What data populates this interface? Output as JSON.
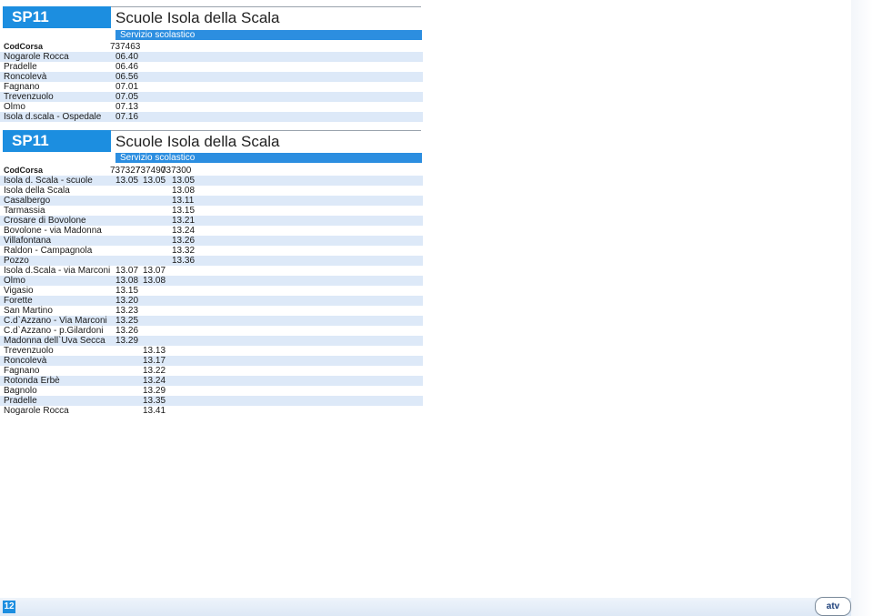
{
  "sections": [
    {
      "code": "SP11",
      "title": "Scuole Isola della Scala",
      "subtitle": "Servizio scolastico",
      "cod_label": "CodCorsa",
      "codes": [
        "737463"
      ],
      "stops": [
        {
          "name": "Nogarole Rocca",
          "times": [
            "06.40"
          ]
        },
        {
          "name": "Pradelle",
          "times": [
            "06.46"
          ]
        },
        {
          "name": "Roncolevà",
          "times": [
            "06.56"
          ]
        },
        {
          "name": "Fagnano",
          "times": [
            "07.01"
          ]
        },
        {
          "name": "Trevenzuolo",
          "times": [
            "07.05"
          ]
        },
        {
          "name": "Olmo",
          "times": [
            "07.13"
          ]
        },
        {
          "name": "Isola d.scala - Ospedale",
          "times": [
            "07.16"
          ]
        }
      ]
    },
    {
      "code": "SP11",
      "title": "Scuole Isola della Scala",
      "subtitle": "Servizio scolastico",
      "cod_label": "CodCorsa",
      "codes": [
        "737327",
        "737490",
        "737300"
      ],
      "stops": [
        {
          "name": "Isola d. Scala - scuole",
          "times": [
            "13.05",
            "13.05",
            "13.05"
          ]
        },
        {
          "name": "Isola della Scala",
          "times": [
            "",
            "",
            "13.08"
          ]
        },
        {
          "name": "Casalbergo",
          "times": [
            "",
            "",
            "13.11"
          ]
        },
        {
          "name": "Tarmassia",
          "times": [
            "",
            "",
            "13.15"
          ]
        },
        {
          "name": "Crosare di Bovolone",
          "times": [
            "",
            "",
            "13.21"
          ]
        },
        {
          "name": "Bovolone - via Madonna",
          "times": [
            "",
            "",
            "13.24"
          ]
        },
        {
          "name": "Villafontana",
          "times": [
            "",
            "",
            "13.26"
          ]
        },
        {
          "name": "Raldon - Campagnola",
          "times": [
            "",
            "",
            "13.32"
          ]
        },
        {
          "name": "Pozzo",
          "times": [
            "",
            "",
            "13.36"
          ]
        },
        {
          "name": "Isola d.Scala - via Marconi",
          "times": [
            "13.07",
            "13.07",
            ""
          ]
        },
        {
          "name": "Olmo",
          "times": [
            "13.08",
            "13.08",
            ""
          ]
        },
        {
          "name": "Vigasio",
          "times": [
            "13.15",
            "",
            ""
          ]
        },
        {
          "name": "Forette",
          "times": [
            "13.20",
            "",
            ""
          ]
        },
        {
          "name": "San Martino",
          "times": [
            "13.23",
            "",
            ""
          ]
        },
        {
          "name": "C.d`Azzano - Via Marconi",
          "times": [
            "13.25",
            "",
            ""
          ]
        },
        {
          "name": "C.d`Azzano - p.Gilardoni",
          "times": [
            "13.26",
            "",
            ""
          ]
        },
        {
          "name": "Madonna dell`Uva Secca",
          "times": [
            "13.29",
            "",
            ""
          ]
        },
        {
          "name": "Trevenzuolo",
          "times": [
            "",
            "13.13",
            ""
          ]
        },
        {
          "name": "Roncolevà",
          "times": [
            "",
            "13.17",
            ""
          ]
        },
        {
          "name": "Fagnano",
          "times": [
            "",
            "13.22",
            ""
          ]
        },
        {
          "name": "Rotonda Erbè",
          "times": [
            "",
            "13.24",
            ""
          ]
        },
        {
          "name": "Bagnolo",
          "times": [
            "",
            "13.29",
            ""
          ]
        },
        {
          "name": "Pradelle",
          "times": [
            "",
            "13.35",
            ""
          ]
        },
        {
          "name": "Nogarole Rocca",
          "times": [
            "",
            "13.41",
            ""
          ]
        }
      ]
    }
  ],
  "footer": {
    "page_number": "12",
    "logo_text": "atv"
  },
  "colors": {
    "accent": "#1c8ee0",
    "row_alt": "#dde9f8"
  }
}
